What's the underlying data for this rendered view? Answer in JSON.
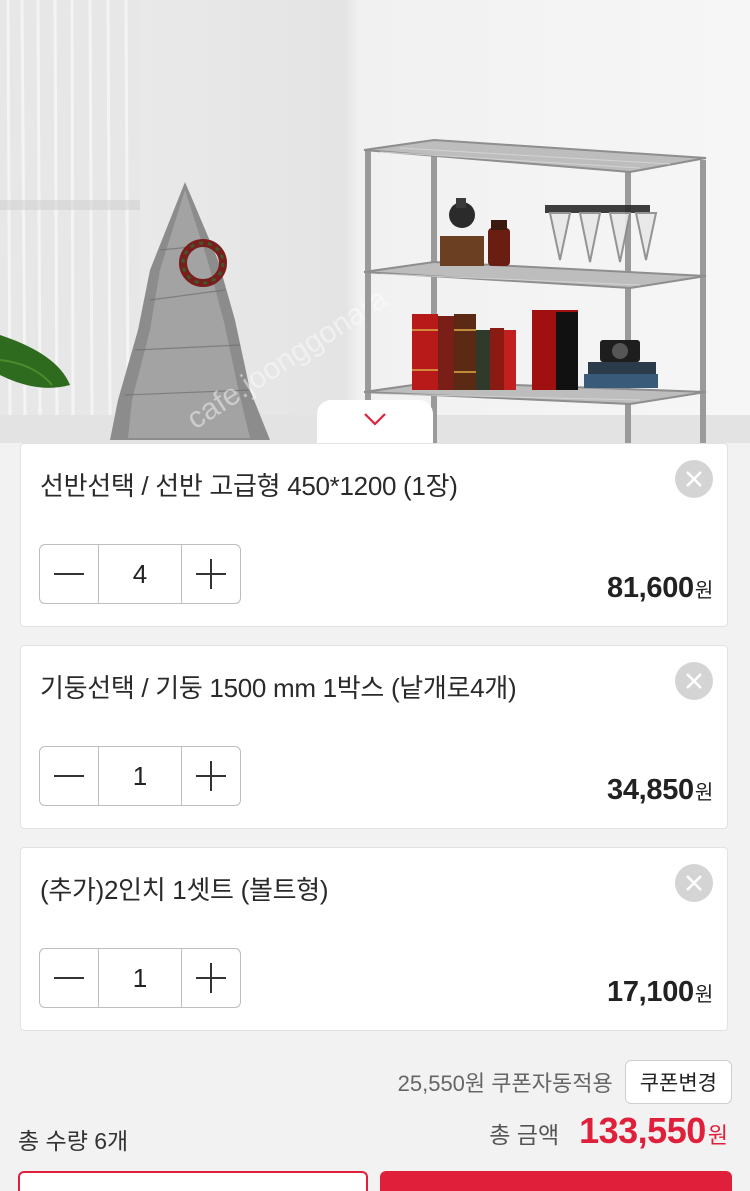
{
  "photo": {
    "alt_label": "product-photo",
    "watermark": "joonggonara"
  },
  "options": [
    {
      "title": "선반선택 / 선반 고급형 450*1200 (1장)",
      "quantity": "4",
      "price": "81,600",
      "currency": "원"
    },
    {
      "title": "기둥선택 / 기둥 1500 mm 1박스 (낱개로4개)",
      "quantity": "1",
      "price": "34,850",
      "currency": "원"
    },
    {
      "title": "(추가)2인치 1셋트 (볼트형)",
      "quantity": "1",
      "price": "17,100",
      "currency": "원"
    }
  ],
  "coupon": {
    "text": "25,550원 쿠폰자동적용",
    "button_label": "쿠폰변경"
  },
  "summary": {
    "total_quantity": "총 수량 6개",
    "total_label": "총 금액",
    "total_amount": "133,550",
    "currency": "원"
  },
  "colors": {
    "accent": "#e0203a",
    "remove_button": "#d4d4d4",
    "background": "#f2f2f2"
  }
}
